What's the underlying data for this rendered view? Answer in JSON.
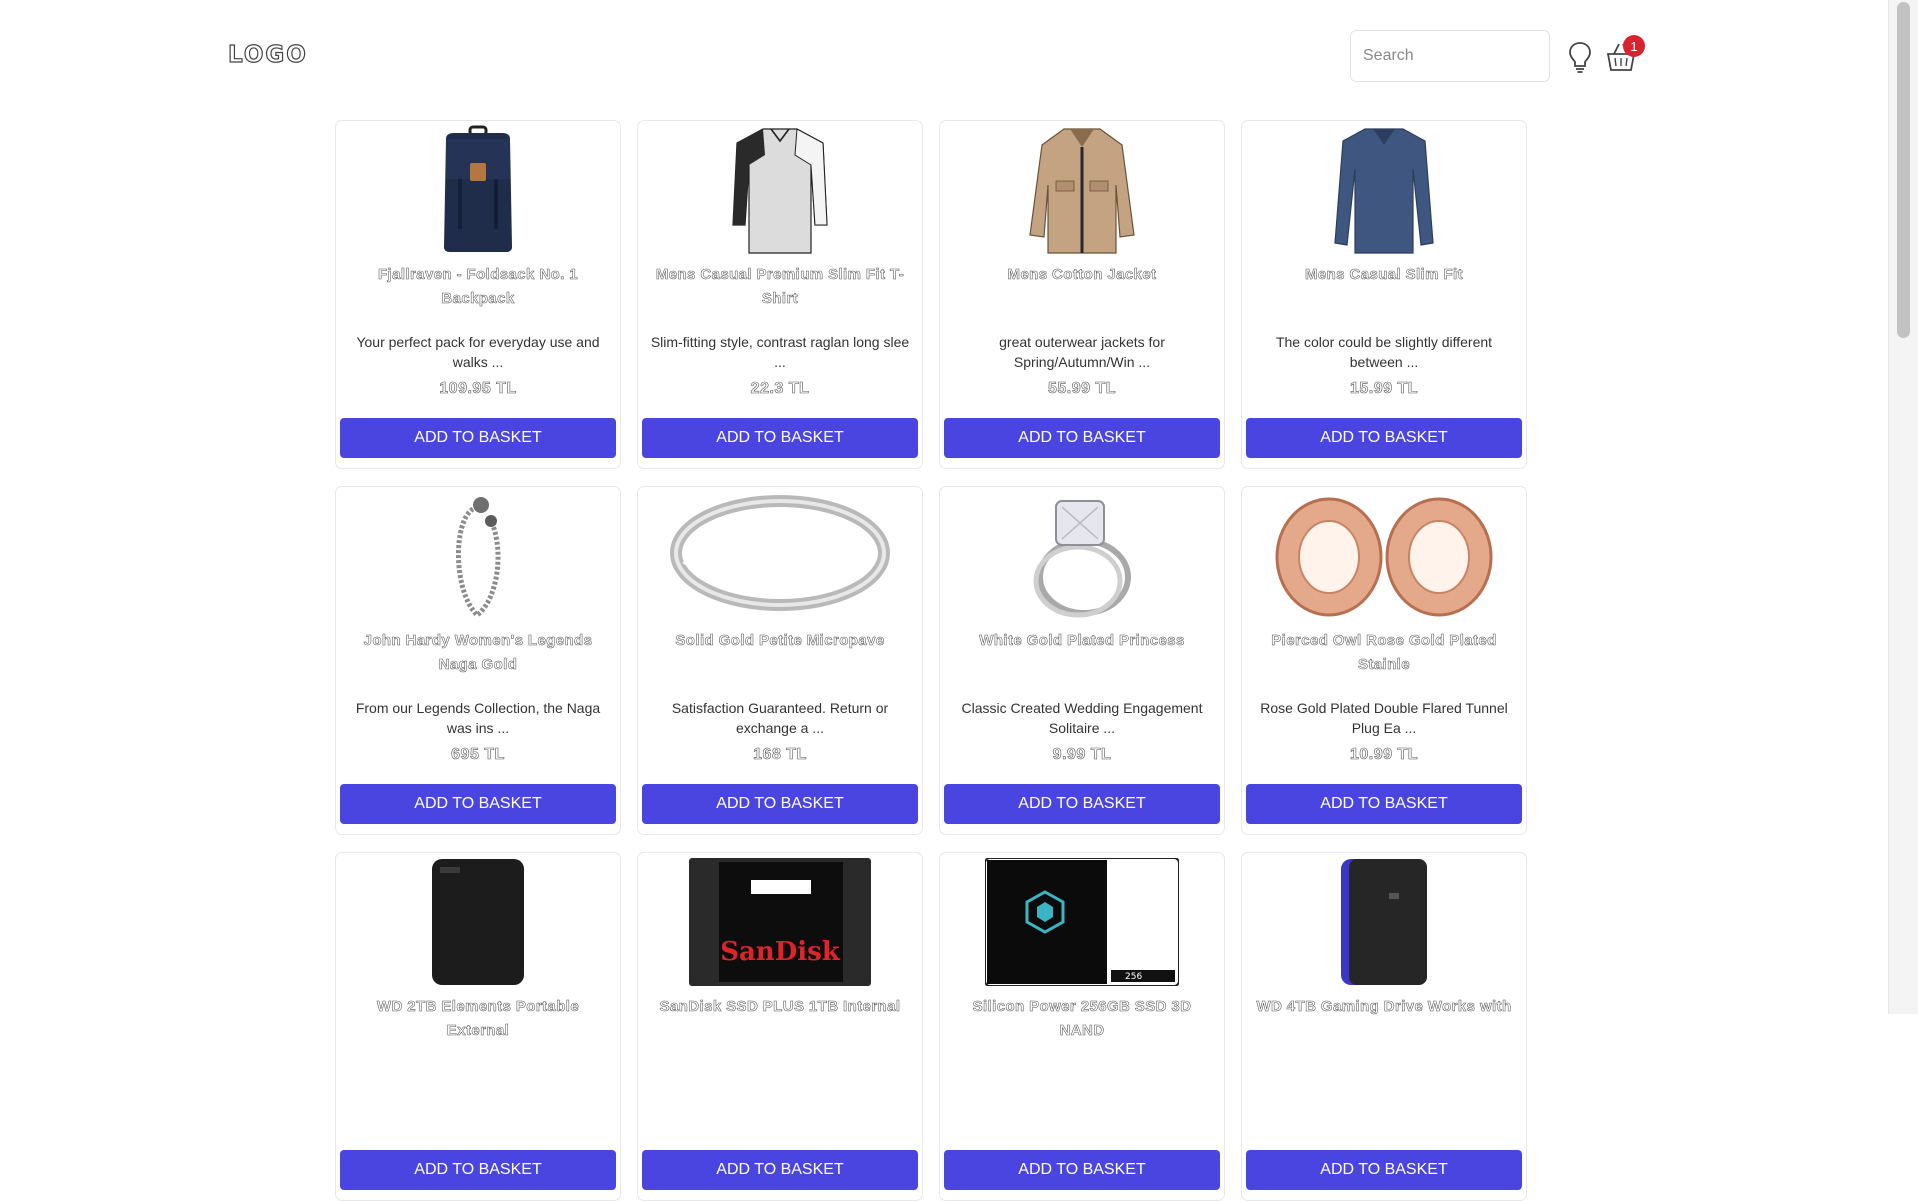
{
  "header": {
    "logo": "LOGO",
    "search_placeholder": "Search",
    "basket_count": "1"
  },
  "products": [
    {
      "title": "Fjallraven - Foldsack No. 1 Backpack",
      "desc": "Your perfect pack for everyday use and walks ...",
      "price": "109.95 TL",
      "button": "ADD TO BASKET",
      "icon": "backpack-image"
    },
    {
      "title": "Mens Casual Premium Slim Fit T-Shirt",
      "desc": "Slim-fitting style, contrast raglan long slee ...",
      "price": "22.3 TL",
      "button": "ADD TO BASKET",
      "icon": "tshirt-image"
    },
    {
      "title": "Mens Cotton Jacket",
      "desc": "great outerwear jackets for Spring/Autumn/Win ...",
      "price": "55.99 TL",
      "button": "ADD TO BASKET",
      "icon": "jacket-image"
    },
    {
      "title": "Mens Casual Slim Fit",
      "desc": "The color could be slightly different between ...",
      "price": "15.99 TL",
      "button": "ADD TO BASKET",
      "icon": "longsleeve-image"
    },
    {
      "title": "John Hardy Women's Legends Naga Gold",
      "desc": "From our Legends Collection, the Naga was ins ...",
      "price": "695 TL",
      "button": "ADD TO BASKET",
      "icon": "bracelet-image"
    },
    {
      "title": "Solid Gold Petite Micropave",
      "desc": "Satisfaction Guaranteed. Return or exchange a ...",
      "price": "168 TL",
      "button": "ADD TO BASKET",
      "icon": "ring-band-image"
    },
    {
      "title": "White Gold Plated Princess",
      "desc": "Classic Created Wedding Engagement Solitaire ...",
      "price": "9.99 TL",
      "button": "ADD TO BASKET",
      "icon": "engagement-ring-image"
    },
    {
      "title": "Pierced Owl Rose Gold Plated Stainle",
      "desc": "Rose Gold Plated Double Flared Tunnel Plug Ea ...",
      "price": "10.99 TL",
      "button": "ADD TO BASKET",
      "icon": "tunnel-plug-image"
    },
    {
      "title": "WD 2TB Elements Portable External",
      "desc": "",
      "price": "",
      "button": "ADD TO BASKET",
      "icon": "hard-drive-image"
    },
    {
      "title": "SanDisk SSD PLUS 1TB Internal",
      "desc": "",
      "price": "",
      "button": "ADD TO BASKET",
      "icon": "ssd-image",
      "brand_text": "SanDisk"
    },
    {
      "title": "Silicon Power 256GB SSD 3D NAND",
      "desc": "",
      "price": "",
      "button": "ADD TO BASKET",
      "icon": "ssd-box-image",
      "capacity_text": "256"
    },
    {
      "title": "WD 4TB Gaming Drive Works with",
      "desc": "",
      "price": "",
      "button": "ADD TO BASKET",
      "icon": "gaming-drive-image"
    }
  ]
}
